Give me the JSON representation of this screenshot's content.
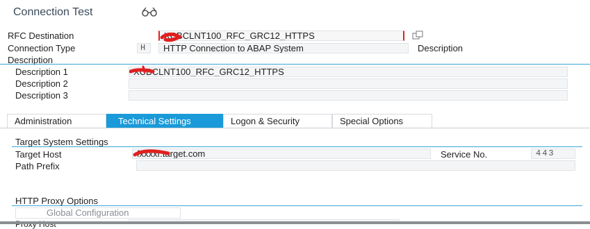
{
  "title": "Connection Test",
  "title_icon": "glasses-icon",
  "header": {
    "rfc_destination_label": "RFC Destination",
    "rfc_destination_value": "XCBCLNT100_RFC_GRC12_HTTPS",
    "connection_type_label": "Connection Type",
    "connection_type_code": "H",
    "connection_type_value": "HTTP Connection to ABAP System",
    "description_button": "Description",
    "description_section": "Description"
  },
  "description": {
    "d1_label": "Description 1",
    "d1_value": "XCBCLNT100_RFC_GRC12_HTTPS",
    "d2_label": "Description 2",
    "d2_value": "",
    "d3_label": "Description 3",
    "d3_value": ""
  },
  "tabs": [
    "Administration",
    "Technical Settings",
    "Logon & Security",
    "Special Options"
  ],
  "active_tab": "Technical Settings",
  "target": {
    "section_title": "Target System Settings",
    "host_label": "Target Host",
    "host_value": "fxxxxr.target.com",
    "service_label": "Service No.",
    "service_value": "443",
    "path_label": "Path Prefix",
    "path_value": ""
  },
  "proxy": {
    "section_title": "HTTP Proxy Options",
    "global_button": "Global Configuration",
    "proxy_host_label": "Proxy Host"
  },
  "colors": {
    "accent": "#1a9ad8",
    "redaction": "#e02020"
  }
}
